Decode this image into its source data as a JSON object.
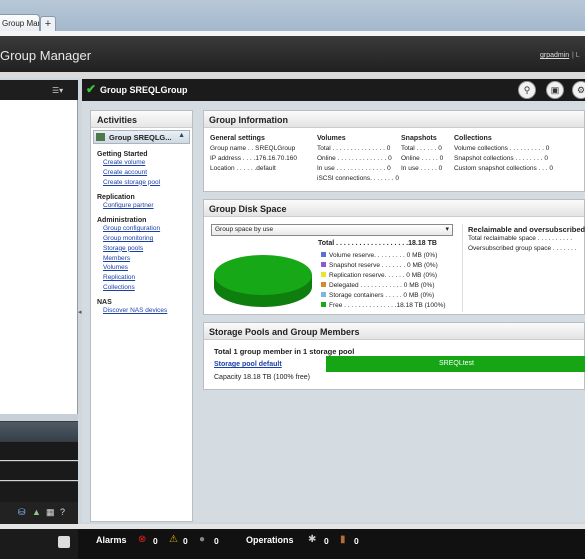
{
  "browser": {
    "tab_label": "Group Manager",
    "new_tab_label": "+"
  },
  "header": {
    "app_title": "Group Manager",
    "user": "grpadmin",
    "separator": "| L"
  },
  "left_nav": {
    "menu_icon": "☰▾"
  },
  "main": {
    "title": "Group SREQLGroup"
  },
  "activities": {
    "title": "Activities",
    "group_label": "Group SREQLG...",
    "sections": [
      {
        "title": "Getting Started",
        "links": [
          "Create volume",
          "Create account",
          "Create storage pool"
        ]
      },
      {
        "title": "Replication",
        "links": [
          "Configure partner"
        ]
      },
      {
        "title": "Administration",
        "links": [
          "Group configuration",
          "Group monitoring",
          "Storage pools",
          "Members",
          "Volumes",
          "Replication",
          "Collections"
        ]
      },
      {
        "title": "NAS",
        "links": [
          "Discover NAS devices"
        ]
      }
    ]
  },
  "group_info": {
    "title": "Group Information",
    "general": {
      "heading": "General settings",
      "rows": [
        "Group name . . SREQLGroup",
        "IP address . . . .176.16.70.160",
        "Location . . . . . .default"
      ]
    },
    "volumes": {
      "heading": "Volumes",
      "rows": [
        "Total . . . . . . . . . . . . . . . 0",
        "Online . . . . . . . . . . . . . . 0",
        "In use . . . . . . . . . . . . . . 0",
        "iSCSI connections. . . . . . . 0"
      ]
    },
    "snapshots": {
      "heading": "Snapshots",
      "rows": [
        "Total . . . . . . 0",
        "Online . . . . . 0",
        "In use . . . . . 0"
      ]
    },
    "collections": {
      "heading": "Collections",
      "rows": [
        "Volume collections . . . . . . . . . . 0",
        "Snapshot collections . . . . . . . . 0",
        "Custom snapshot collections . . . 0"
      ]
    }
  },
  "disk_space": {
    "title": "Group Disk Space",
    "select_value": "Group space by use",
    "total": "Total . . . . . . . . . . . . . . . . . . .18.18 TB",
    "legend": [
      {
        "label": "Volume reserve. . . . . . . . . 0 MB (0%)",
        "color": "#5a6fd8"
      },
      {
        "label": "Snapshot reserve . . . . . . . 0 MB (0%)",
        "color": "#8a5ad0"
      },
      {
        "label": "Replication reserve. . . . . . 0 MB (0%)",
        "color": "#e6e62a"
      },
      {
        "label": "Delegated . . . . . . . . . . . . 0 MB (0%)",
        "color": "#d88a2a"
      },
      {
        "label": "Storage containers . . . . . 0 MB (0%)",
        "color": "#7ab8e0"
      },
      {
        "label": "Free . . . . . . . . . . . . . . .18.18 TB (100%)",
        "color": "#18a818"
      }
    ],
    "reclaim_title": "Reclaimable and oversubscribed",
    "reclaim_rows": [
      "Total reclaimable space . . . . . . . . . .",
      "Oversubscribed group space . . . . . . ."
    ]
  },
  "storage": {
    "title": "Storage Pools and Group Members",
    "summary": "Total 1 group member in 1 storage pool",
    "pool_link": "Storage pool default",
    "capacity": "Capacity 18.18 TB (100% free)",
    "member": "SREQLtest",
    "free_fraction": 1.0
  },
  "bottom": {
    "alarms_label": "Alarms",
    "alarm_counts": [
      "0",
      "0",
      "0"
    ],
    "operations_label": "Operations",
    "operation_counts": [
      "0",
      "0"
    ]
  }
}
